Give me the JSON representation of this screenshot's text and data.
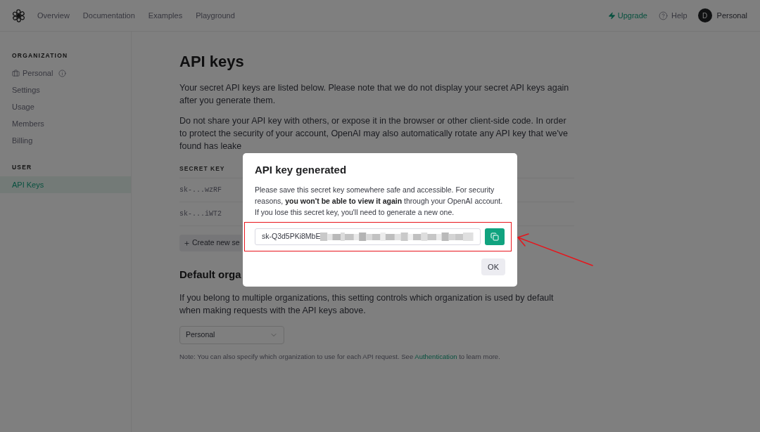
{
  "top_nav": {
    "links": [
      "Overview",
      "Documentation",
      "Examples",
      "Playground"
    ],
    "upgrade": "Upgrade",
    "help": "Help",
    "account": {
      "initial": "D",
      "name": "Personal"
    }
  },
  "sidebar": {
    "sections": [
      {
        "heading": "ORGANIZATION",
        "items": [
          {
            "kind": "organization",
            "label": "Personal",
            "selected": false
          },
          {
            "kind": "link",
            "label": "Settings",
            "selected": false
          },
          {
            "kind": "link",
            "label": "Usage",
            "selected": false
          },
          {
            "kind": "link",
            "label": "Members",
            "selected": false
          },
          {
            "kind": "link",
            "label": "Billing",
            "selected": false
          }
        ]
      },
      {
        "heading": "USER",
        "items": [
          {
            "kind": "link",
            "label": "API Keys",
            "selected": true
          }
        ]
      }
    ]
  },
  "page": {
    "title": "API keys",
    "intro": "Your secret API keys are listed below. Please note that we do not display your secret API keys again after you generate them.",
    "warning": "Do not share your API key with others, or expose it in the browser or other client-side code. In order to protect the security of your account, OpenAI may also automatically rotate any API key that we've found has leake",
    "table": {
      "columns": [
        "SECRET KEY"
      ],
      "rows": [
        [
          "sk-...wzRF"
        ],
        [
          "sk-...iWT2"
        ]
      ]
    },
    "create_button": "Create new se",
    "default_org": {
      "heading": "Default orga",
      "description": "If you belong to multiple organizations, this setting controls which organization is used by default when making requests with the API keys above.",
      "select_value": "Personal",
      "note": {
        "before": "Note: You can also specify which organization to use for each API request. See ",
        "link": "Authentication",
        "after": " to learn more."
      }
    }
  },
  "modal": {
    "title": "API key generated",
    "message": "Please save this secret key somewhere safe and accessible. For security reasons, **you won't be able to view it again** through your OpenAI account. If you lose this secret key, you'll need to generate a new one.",
    "key_value": "sk-Q3d5PKi8MbE",
    "ok_button": "OK"
  }
}
